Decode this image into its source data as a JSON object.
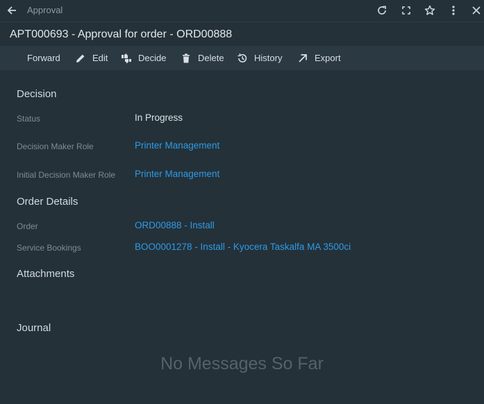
{
  "header": {
    "breadcrumb": "Approval",
    "title": "APT000693 - Approval for order - ORD00888"
  },
  "toolbar": {
    "forward": "Forward",
    "edit": "Edit",
    "decide": "Decide",
    "delete": "Delete",
    "history": "History",
    "export": "Export"
  },
  "decision": {
    "title": "Decision",
    "status_label": "Status",
    "status_value": "In Progress",
    "maker_role_label": "Decision Maker Role",
    "maker_role_value": "Printer Management",
    "initial_role_label": "Initial Decision Maker Role",
    "initial_role_value": "Printer Management"
  },
  "order_details": {
    "title": "Order Details",
    "order_label": "Order",
    "order_value": "ORD00888 - Install",
    "bookings_label": "Service Bookings",
    "bookings_value": "BOO0001278 - Install - Kyocera Taskalfa MA 3500ci"
  },
  "attachments": {
    "title": "Attachments"
  },
  "journal": {
    "title": "Journal",
    "empty_message": "No Messages So Far"
  },
  "icons": {
    "back": "arrow-left-icon",
    "refresh": "refresh-icon",
    "fullscreen": "fullscreen-icon",
    "favorite": "star-icon",
    "more": "more-vertical-icon",
    "close": "close-icon"
  },
  "colors": {
    "background": "#243139",
    "toolbar": "#2b3942",
    "link": "#2f9ae6",
    "muted_label": "#7f8c94"
  }
}
